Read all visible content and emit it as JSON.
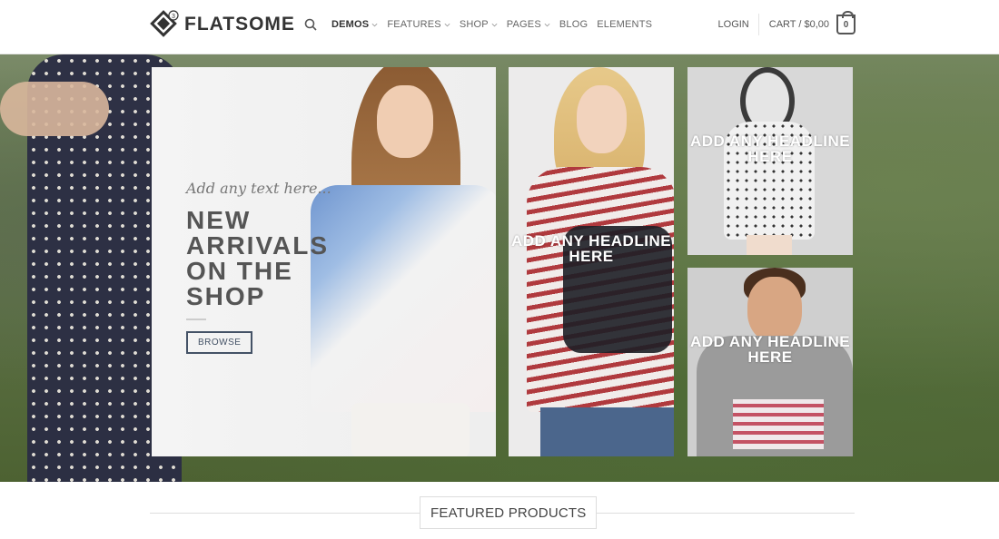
{
  "header": {
    "logo_text": "FLATSOME",
    "logo_badge": "3",
    "nav": [
      {
        "label": "DEMOS",
        "has_dropdown": true,
        "active": true
      },
      {
        "label": "FEATURES",
        "has_dropdown": true,
        "active": false
      },
      {
        "label": "SHOP",
        "has_dropdown": true,
        "active": false
      },
      {
        "label": "PAGES",
        "has_dropdown": true,
        "active": false
      },
      {
        "label": "BLOG",
        "has_dropdown": false,
        "active": false
      },
      {
        "label": "ELEMENTS",
        "has_dropdown": false,
        "active": false
      }
    ],
    "login_label": "LOGIN",
    "cart_label": "CART / $0,00",
    "cart_count": "0"
  },
  "hero": {
    "main_tile": {
      "tagline": "Add any text here...",
      "headline": "NEW ARRIVALS ON THE SHOP",
      "button_label": "BROWSE"
    },
    "tiles": [
      {
        "headline": "ADD ANY HEADLINE HERE"
      },
      {
        "headline": "ADD ANY HEADLINE HERE"
      },
      {
        "headline": "ADD ANY HEADLINE HERE"
      }
    ]
  },
  "featured": {
    "title": "FEATURED PRODUCTS"
  },
  "colors": {
    "accent": "#445266",
    "text": "#555555",
    "nav_text": "#666666"
  },
  "icons": [
    "logo-diamond-icon",
    "search-icon",
    "chevron-down-icon",
    "cart-bag-icon"
  ]
}
